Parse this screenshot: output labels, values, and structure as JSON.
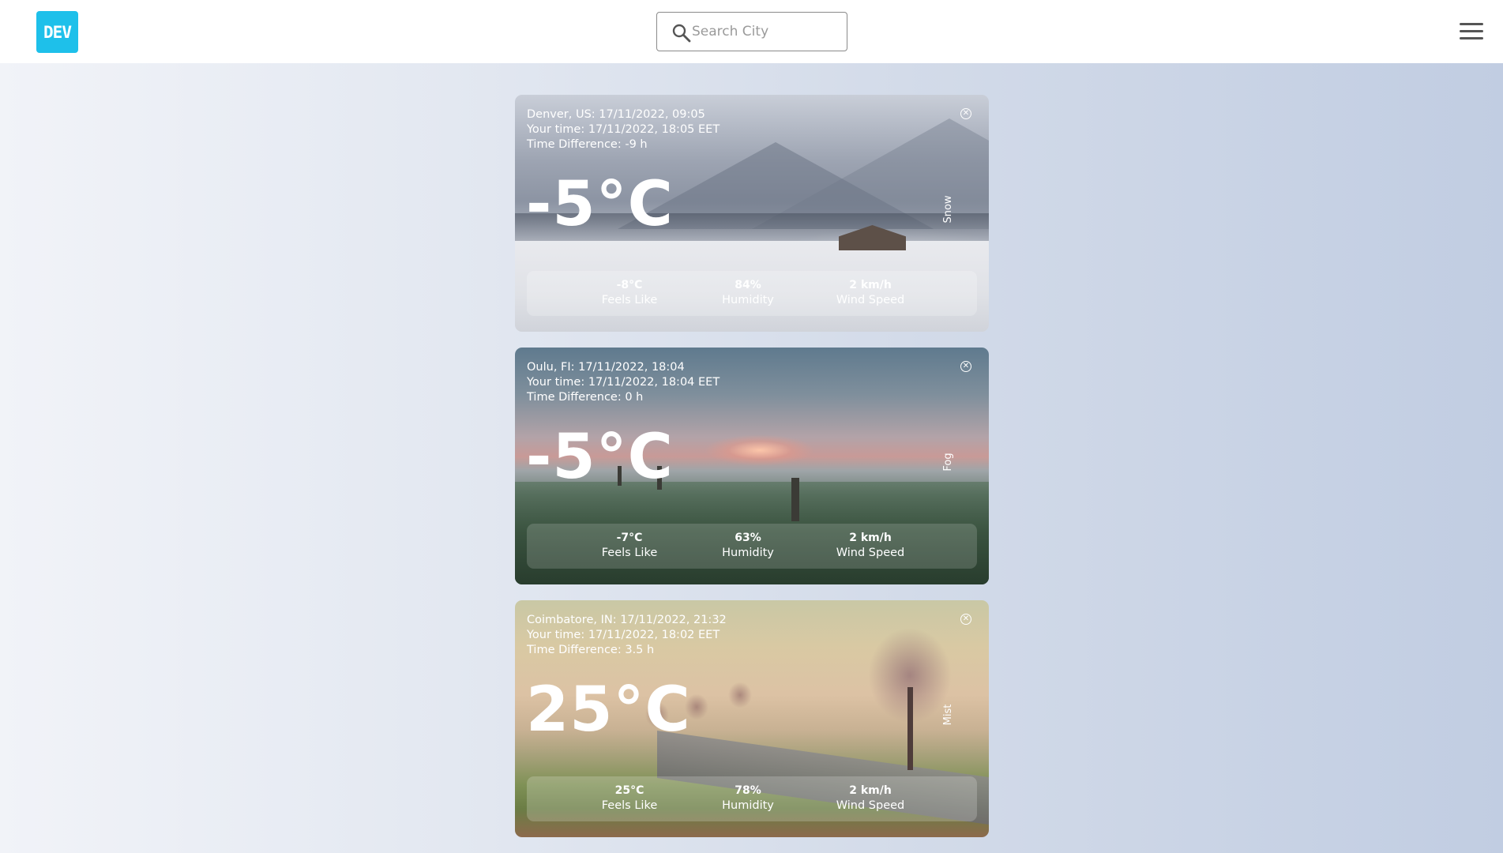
{
  "header": {
    "logo_text": "DEV",
    "search": {
      "placeholder": "Search City",
      "value": ""
    },
    "menu_icon": "hamburger-menu-icon"
  },
  "cards": [
    {
      "location_line": "Denver, US: 17/11/2022, 09:05",
      "your_time_line": "Your time: 17/11/2022, 18:05 EET",
      "time_difference_line": "Time Difference: -9 h",
      "temperature": "-5°C",
      "condition": "Snow",
      "feels_like_value": "-8°C",
      "feels_like_label": "Feels Like",
      "humidity_value": "84%",
      "humidity_label": "Humidity",
      "wind_value": "2 km/h",
      "wind_label": "Wind Speed",
      "background": "snow-landscape"
    },
    {
      "location_line": "Oulu, FI: 17/11/2022, 18:04",
      "your_time_line": "Your time: 17/11/2022, 18:04 EET",
      "time_difference_line": "Time Difference: 0 h",
      "temperature": "-5°C",
      "condition": "Fog",
      "feels_like_value": "-7°C",
      "feels_like_label": "Feels Like",
      "humidity_value": "63%",
      "humidity_label": "Humidity",
      "wind_value": "2 km/h",
      "wind_label": "Wind Speed",
      "background": "foggy-field-sunset"
    },
    {
      "location_line": "Coimbatore, IN: 17/11/2022, 21:32",
      "your_time_line": "Your time: 17/11/2022, 18:02 EET",
      "time_difference_line": "Time Difference: 3.5 h",
      "temperature": "25°C",
      "condition": "Mist",
      "feels_like_value": "25°C",
      "feels_like_label": "Feels Like",
      "humidity_value": "78%",
      "humidity_label": "Humidity",
      "wind_value": "2 km/h",
      "wind_label": "Wind Speed",
      "background": "misty-road-trees"
    }
  ],
  "colors": {
    "logo_bg": "#1ec0ea",
    "header_bg": "#ffffff",
    "page_gradient_start": "#f1f3f8",
    "page_gradient_end": "#c1cde2"
  }
}
